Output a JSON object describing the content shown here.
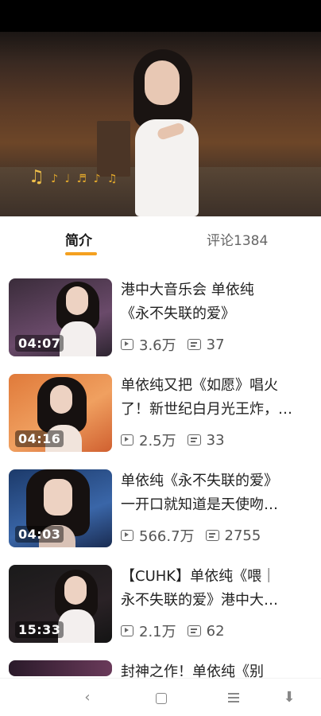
{
  "tabs": [
    {
      "label": "简介",
      "active": true
    },
    {
      "label": "评论1384",
      "active": false
    }
  ],
  "accent_color": "#f4a020",
  "videos": [
    {
      "title_line1": "港中大音乐会 单依纯",
      "title_line2": "《永不失联的爱》",
      "duration": "04:07",
      "views": "3.6万",
      "danmaku": "37"
    },
    {
      "title_line1": "单依纯又把《如愿》唱火",
      "title_line2": "了！新世纪白月光王炸，…",
      "duration": "04:16",
      "views": "2.5万",
      "danmaku": "33"
    },
    {
      "title_line1": "单依纯《永不失联的爱》",
      "title_line2": "一开口就知道是天使吻…",
      "duration": "04:03",
      "views": "566.7万",
      "danmaku": "2755"
    },
    {
      "title_line1": "【CUHK】单依纯《喂｜",
      "title_line2": "永不失联的爱》港中大…",
      "duration": "15:33",
      "views": "2.1万",
      "danmaku": "62"
    },
    {
      "title_line1": "封神之作！单依纯《别",
      "title_line2": "",
      "duration": "",
      "views": "",
      "danmaku": ""
    }
  ],
  "icons": {
    "play_count": "play-count-icon",
    "danmaku_count": "danmaku-icon",
    "nav_back": "chevron-left-icon",
    "nav_home": "square-home-icon",
    "nav_menu": "hamburger-menu-icon",
    "nav_extra": "accessibility-icon"
  },
  "nav": {
    "back_glyph": "‹",
    "extra_glyph": "⬇"
  }
}
